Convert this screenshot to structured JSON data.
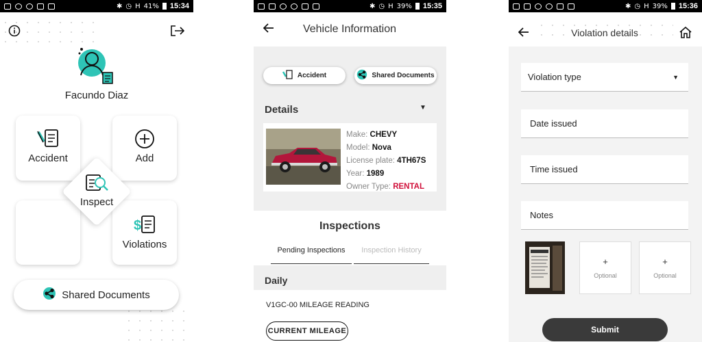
{
  "screens": [
    {
      "status": {
        "battery": "41%",
        "time": "15:34",
        "signal": "H"
      },
      "user_name": "Facundo Diaz",
      "tiles": {
        "accident": "Accident",
        "add": "Add",
        "inspect": "Inspect",
        "violations": "Violations"
      },
      "shared_documents": "Shared Documents",
      "icons": {
        "info": "info-icon",
        "logout": "logout-icon",
        "avatar": "user-avatar-icon"
      }
    },
    {
      "status": {
        "battery": "39%",
        "time": "15:35",
        "signal": "H"
      },
      "title": "Vehicle Information",
      "buttons": {
        "accident": "Accident",
        "shared_documents": "Shared Documents"
      },
      "details_heading": "Details",
      "vehicle": {
        "make_label": "Make:",
        "make": "CHEVY",
        "model_label": "Model:",
        "model": "Nova",
        "plate_label": "License plate:",
        "plate": "4TH67S",
        "year_label": "Year:",
        "year": "1989",
        "owner_label": "Owner Type:",
        "owner": "RENTAL"
      },
      "inspections_heading": "Inspections",
      "tabs": {
        "pending": "Pending Inspections",
        "history": "Inspection History"
      },
      "daily_heading": "Daily",
      "daily_item": "V1GC-00 MILEAGE READING",
      "mileage_button": "CURRENT MILEAGE"
    },
    {
      "status": {
        "battery": "39%",
        "time": "15:36",
        "signal": "H"
      },
      "title": "Violation details",
      "fields": {
        "type": "Violation type",
        "date": "Date issued",
        "time": "Time issued",
        "notes": "Notes"
      },
      "photo_slots": [
        {
          "plus": "+",
          "label": "Optional"
        },
        {
          "plus": "+",
          "label": "Optional"
        }
      ],
      "submit": "Submit"
    }
  ],
  "colors": {
    "accent": "#2ec4b6",
    "alert": "#d0103a",
    "dark_button": "#3a3a3a"
  }
}
